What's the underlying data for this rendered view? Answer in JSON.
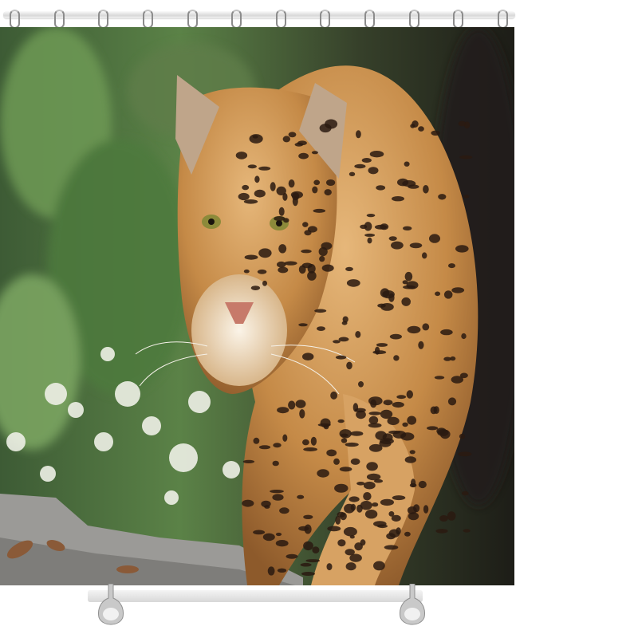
{
  "scene": {
    "subject": "jaguar",
    "product": "shower-curtain",
    "colors": {
      "background": "#ffffff",
      "foliage_dark": "#2f4a2b",
      "foliage_mid": "#4f7a3e",
      "fur": "#c9914f",
      "fur_light": "#e3b477",
      "spot": "#2a1a10",
      "rock": "#9a9a98",
      "chrome": "#cfcfcf"
    },
    "hook_count": 12
  }
}
